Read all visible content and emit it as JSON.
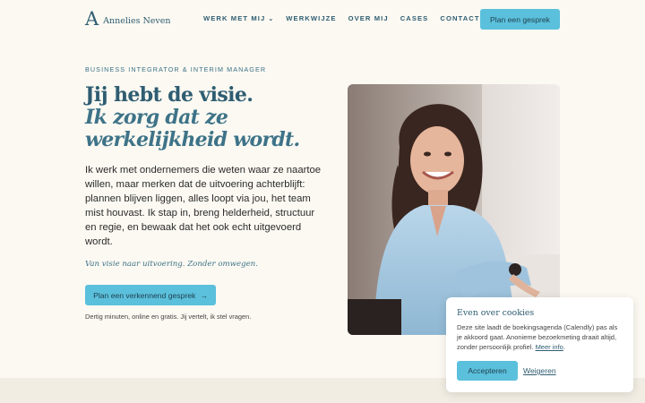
{
  "header": {
    "logo_mark": "A",
    "logo_text": "Annelies Neven",
    "nav": [
      {
        "label": "WERK MET MIJ",
        "has_dropdown": true
      },
      {
        "label": "WERKWIJZE"
      },
      {
        "label": "OVER MIJ"
      },
      {
        "label": "CASES"
      },
      {
        "label": "CONTACT"
      }
    ],
    "cta_label": "Plan een gesprek"
  },
  "hero": {
    "eyebrow": "BUSINESS INTEGRATOR & INTERIM MANAGER",
    "title_line1": "Jij hebt de visie.",
    "title_line2": "Ik zorg dat ze werkelijkheid wordt.",
    "lead": "Ik werk met ondernemers die weten waar ze naartoe willen, maar merken dat de uitvoering achterblijft: plannen blijven liggen, alles loopt via jou, het team mist houvast. Ik stap in, breng helderheid, structuur en regie, en bewaak dat het ook echt uitgevoerd wordt.",
    "tagline": "Van visie naar uitvoering. Zonder omwegen.",
    "cta_label": "Plan een verkennend gesprek",
    "cta_arrow": "→",
    "note": "Dertig minuten, online en gratis. Jij vertelt, ik stel vragen."
  },
  "cookie": {
    "title": "Even over cookies",
    "body": "Deze site laadt de boekingsagenda (Calendly) pas als je akkoord gaat. Anonieme bezoekmeting draait altijd, zonder persoonlijk profiel.",
    "more_link": "Meer info",
    "more_suffix": ".",
    "accept_label": "Accepteren",
    "refuse_label": "Weigeren"
  },
  "colors": {
    "background": "#fbf9f2",
    "accent": "#5bc0dc",
    "brand": "#2f5d72"
  }
}
